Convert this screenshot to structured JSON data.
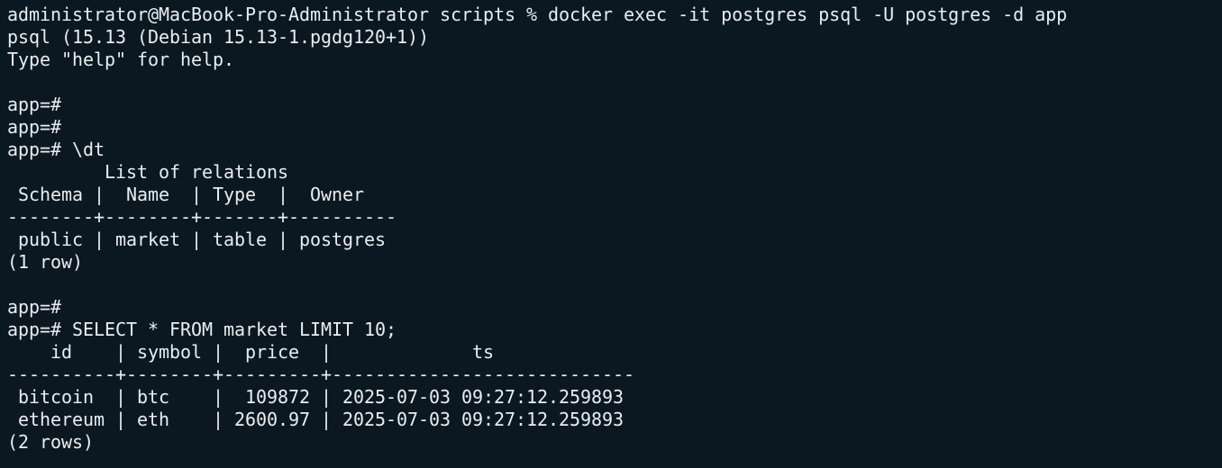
{
  "terminal": {
    "lines": [
      "administrator@MacBook-Pro-Administrator scripts % docker exec -it postgres psql -U postgres -d app",
      "psql (15.13 (Debian 15.13-1.pgdg120+1))",
      "Type \"help\" for help.",
      "",
      "app=#",
      "app=#",
      "app=# \\dt",
      "         List of relations",
      " Schema |  Name  | Type  |  Owner",
      "--------+--------+-------+----------",
      " public | market | table | postgres",
      "(1 row)",
      "",
      "app=#",
      "app=# SELECT * FROM market LIMIT 10;",
      "    id    | symbol |  price  |             ts",
      "----------+--------+---------+----------------------------",
      " bitcoin  | btc    |  109872 | 2025-07-03 09:27:12.259893",
      " ethereum | eth    | 2600.97 | 2025-07-03 09:27:12.259893",
      "(2 rows)"
    ]
  }
}
